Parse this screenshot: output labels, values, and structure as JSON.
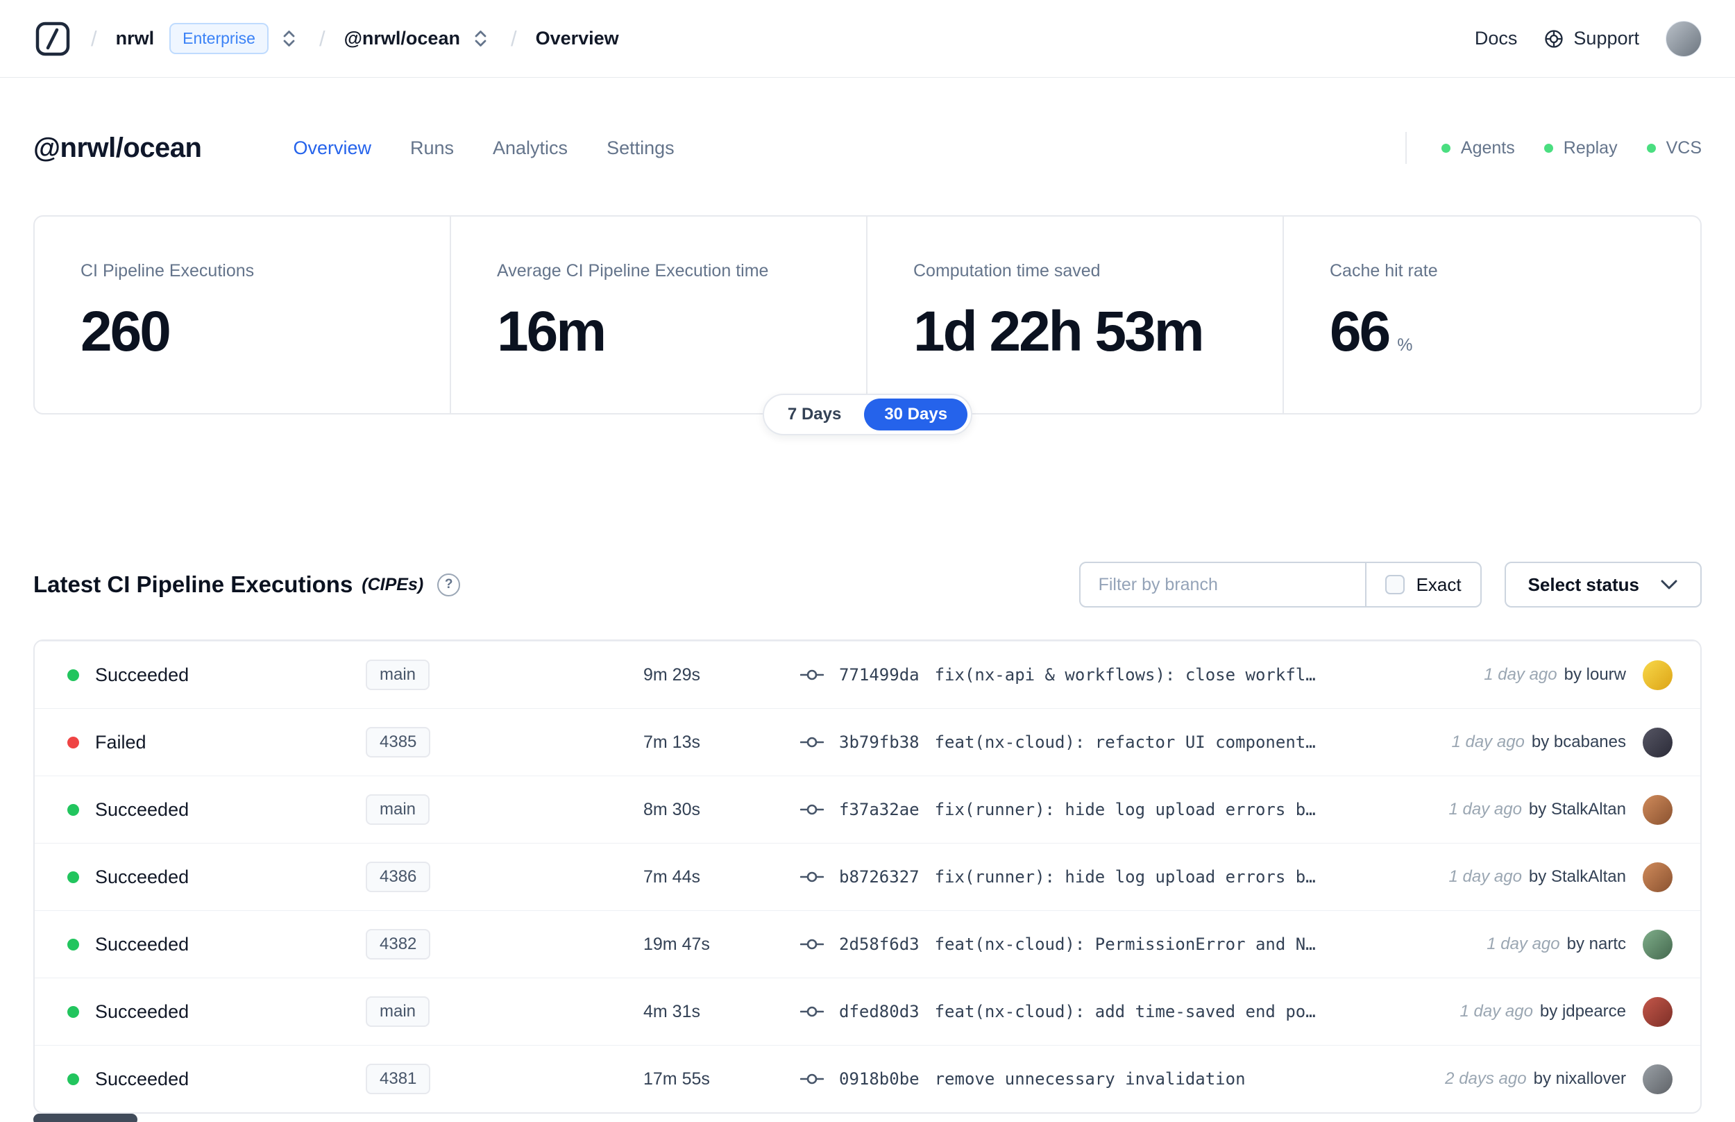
{
  "topbar": {
    "breadcrumb": {
      "separator": "/",
      "org": "nrwl",
      "org_badge": "Enterprise",
      "workspace": "@nrwl/ocean",
      "page": "Overview"
    },
    "docs_label": "Docs",
    "support_label": "Support",
    "avatar_colors": "#b9c0c8,#6d7680"
  },
  "header": {
    "title": "@nrwl/ocean",
    "tabs": [
      {
        "label": "Overview",
        "active": true
      },
      {
        "label": "Runs"
      },
      {
        "label": "Analytics"
      },
      {
        "label": "Settings"
      }
    ],
    "indicators": [
      {
        "label": "Agents"
      },
      {
        "label": "Replay"
      },
      {
        "label": "VCS"
      }
    ]
  },
  "stats": [
    {
      "label": "CI Pipeline Executions",
      "value": "260"
    },
    {
      "label": "Average CI Pipeline Execution time",
      "value": "16m"
    },
    {
      "label": "Computation time saved",
      "value": "1d 22h 53m"
    },
    {
      "label": "Cache hit rate",
      "value": "66",
      "unit": "%"
    }
  ],
  "range_toggle": [
    {
      "label": "7 Days"
    },
    {
      "label": "30 Days",
      "active": true
    }
  ],
  "cipes": {
    "title": "Latest CI Pipeline Executions",
    "title_suffix": "(CIPEs)",
    "help_glyph": "?",
    "filter_placeholder": "Filter by branch",
    "exact_label": "Exact",
    "status_dropdown_label": "Select status"
  },
  "rows": [
    {
      "status": "Succeeded",
      "state": "success",
      "branch": "main",
      "duration": "9m 29s",
      "hash": "771499da",
      "message": "fix(nx-api & workflows): close workfl…",
      "time": "1 day ago",
      "author": "by lourw",
      "avatar_colors": "#f8d84a,#dca416"
    },
    {
      "status": "Failed",
      "state": "failed",
      "branch": "4385",
      "duration": "7m 13s",
      "hash": "3b79fb38",
      "message": "feat(nx-cloud): refactor UI component…",
      "time": "1 day ago",
      "author": "by bcabanes",
      "avatar_colors": "#565664,#2b2b38"
    },
    {
      "status": "Succeeded",
      "state": "success",
      "branch": "main",
      "duration": "8m 30s",
      "hash": "f37a32ae",
      "message": "fix(runner): hide log upload errors b…",
      "time": "1 day ago",
      "author": "by StalkAltan",
      "avatar_colors": "#d08b5b,#8a5230"
    },
    {
      "status": "Succeeded",
      "state": "success",
      "branch": "4386",
      "duration": "7m 44s",
      "hash": "b8726327",
      "message": "fix(runner): hide log upload errors b…",
      "time": "1 day ago",
      "author": "by StalkAltan",
      "avatar_colors": "#d08b5b,#8a5230"
    },
    {
      "status": "Succeeded",
      "state": "success",
      "branch": "4382",
      "duration": "19m 47s",
      "hash": "2d58f6d3",
      "message": "feat(nx-cloud): PermissionError and N…",
      "time": "1 day ago",
      "author": "by nartc",
      "avatar_colors": "#7fae8a,#44684e"
    },
    {
      "status": "Succeeded",
      "state": "success",
      "branch": "main",
      "duration": "4m 31s",
      "hash": "dfed80d3",
      "message": "feat(nx-cloud): add time-saved end po…",
      "time": "1 day ago",
      "author": "by jdpearce",
      "avatar_colors": "#c4574a,#7d2f27"
    },
    {
      "status": "Succeeded",
      "state": "success",
      "branch": "4381",
      "duration": "17m 55s",
      "hash": "0918b0be",
      "message": "remove unnecessary invalidation",
      "time": "2 days ago",
      "author": "by nixallover",
      "avatar_colors": "#9aa0a6,#5f6368"
    }
  ],
  "colors": {
    "accent": "#2563eb",
    "success_dot": "#22c55e",
    "failed_dot": "#ef4444",
    "badge_text": "#3b82f6"
  }
}
